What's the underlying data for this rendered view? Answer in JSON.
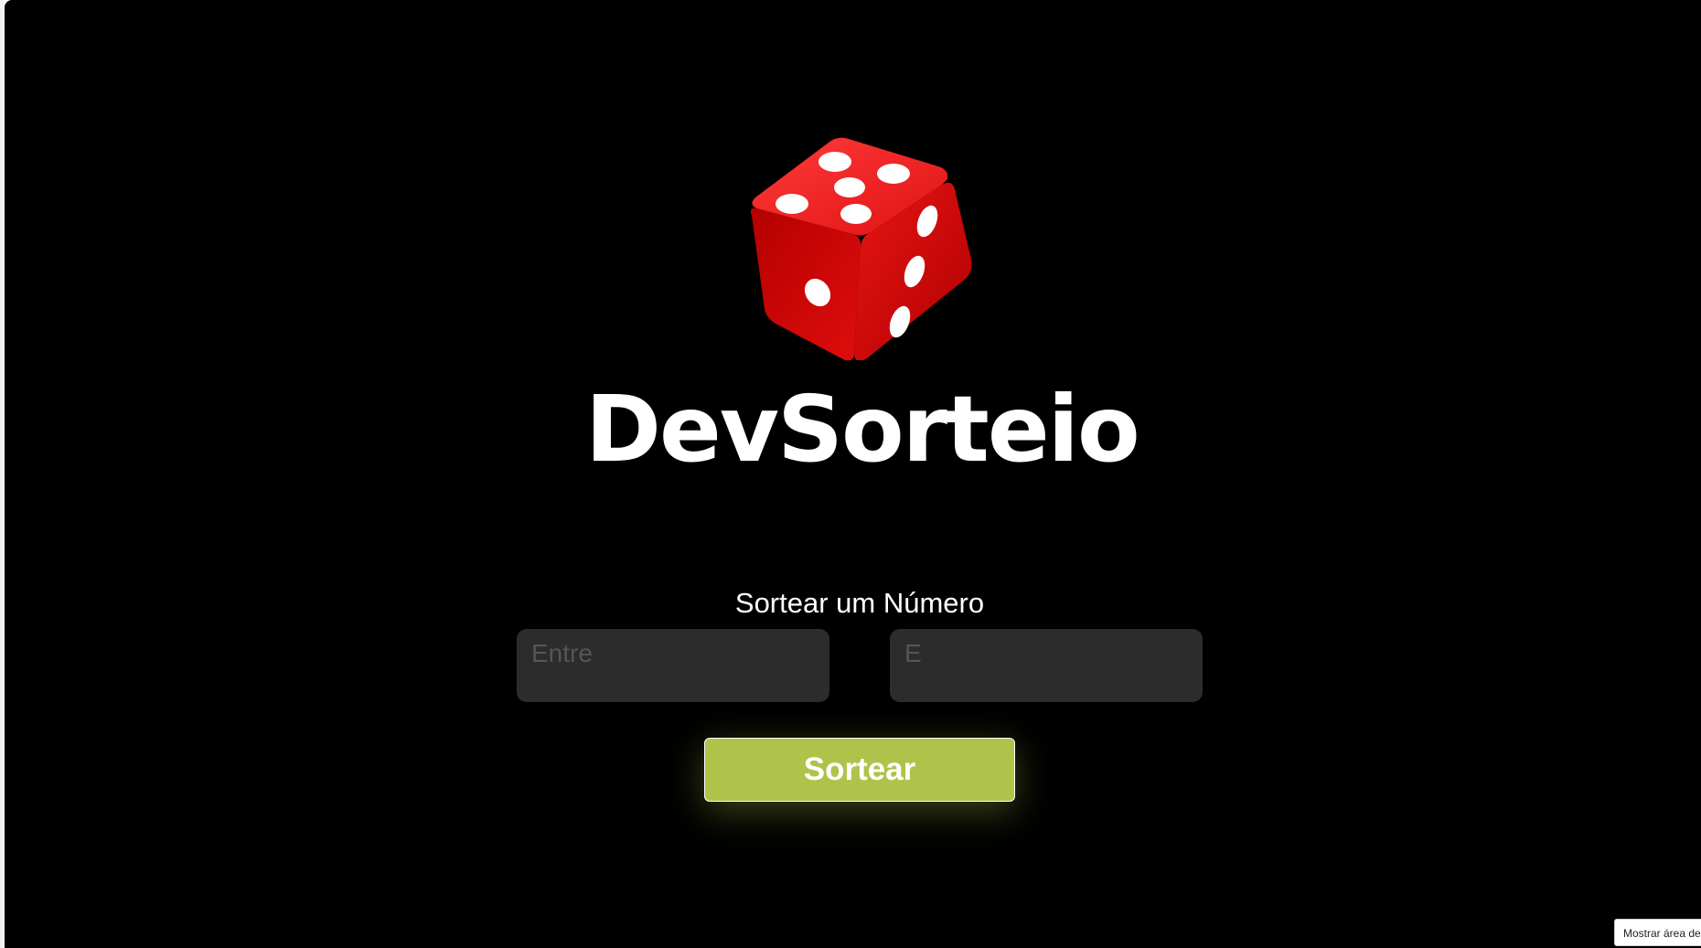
{
  "app": {
    "title": "DevSorteio",
    "logo_icon": "red-dice-icon",
    "subtitle": "Sortear um Número"
  },
  "form": {
    "from_placeholder": "Entre",
    "from_value": "",
    "to_placeholder": "E",
    "to_value": "",
    "draw_button_label": "Sortear"
  },
  "tooltip": {
    "text": "Mostrar área de"
  },
  "colors": {
    "background": "#000000",
    "input_background": "#2c2c2c",
    "button_accent": "#afc24a",
    "dice_red": "#e01010",
    "text": "#ffffff"
  }
}
